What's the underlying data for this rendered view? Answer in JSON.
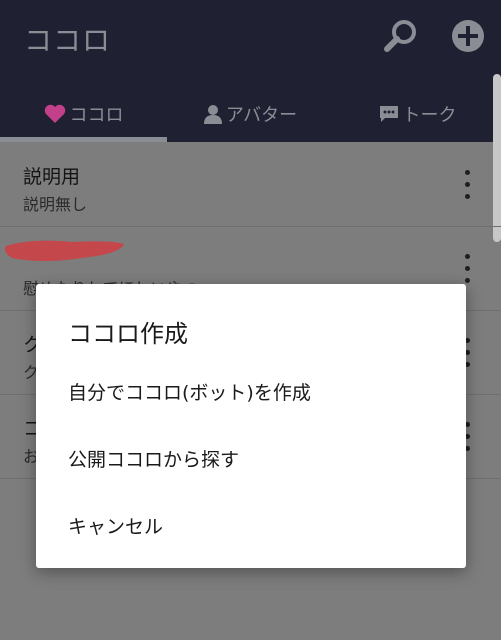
{
  "app": {
    "title": "ココロ"
  },
  "tabs": [
    {
      "label": "ココロ",
      "icon": "heart-icon",
      "active": true
    },
    {
      "label": "アバター",
      "icon": "person-icon",
      "active": false
    },
    {
      "label": "トーク",
      "icon": "chat-icon",
      "active": false
    }
  ],
  "list": {
    "items": [
      {
        "name": "説明用",
        "description": "説明無し"
      },
      {
        "name": "",
        "description": "慰めたりしてほしいやつ"
      },
      {
        "name": "ク",
        "description": "ク"
      },
      {
        "name": "コ",
        "description": "お"
      }
    ]
  },
  "dialog": {
    "title": "ココロ作成",
    "options": [
      "自分でココロ(ボット)を作成",
      "公開ココロから探す",
      "キャンセル"
    ]
  },
  "colors": {
    "appbar": "#1f2133",
    "overlay_text": "#8b8d95",
    "heart": "#c2408a",
    "redaction": "#e2565a",
    "dialog_bg": "#ffffff"
  }
}
